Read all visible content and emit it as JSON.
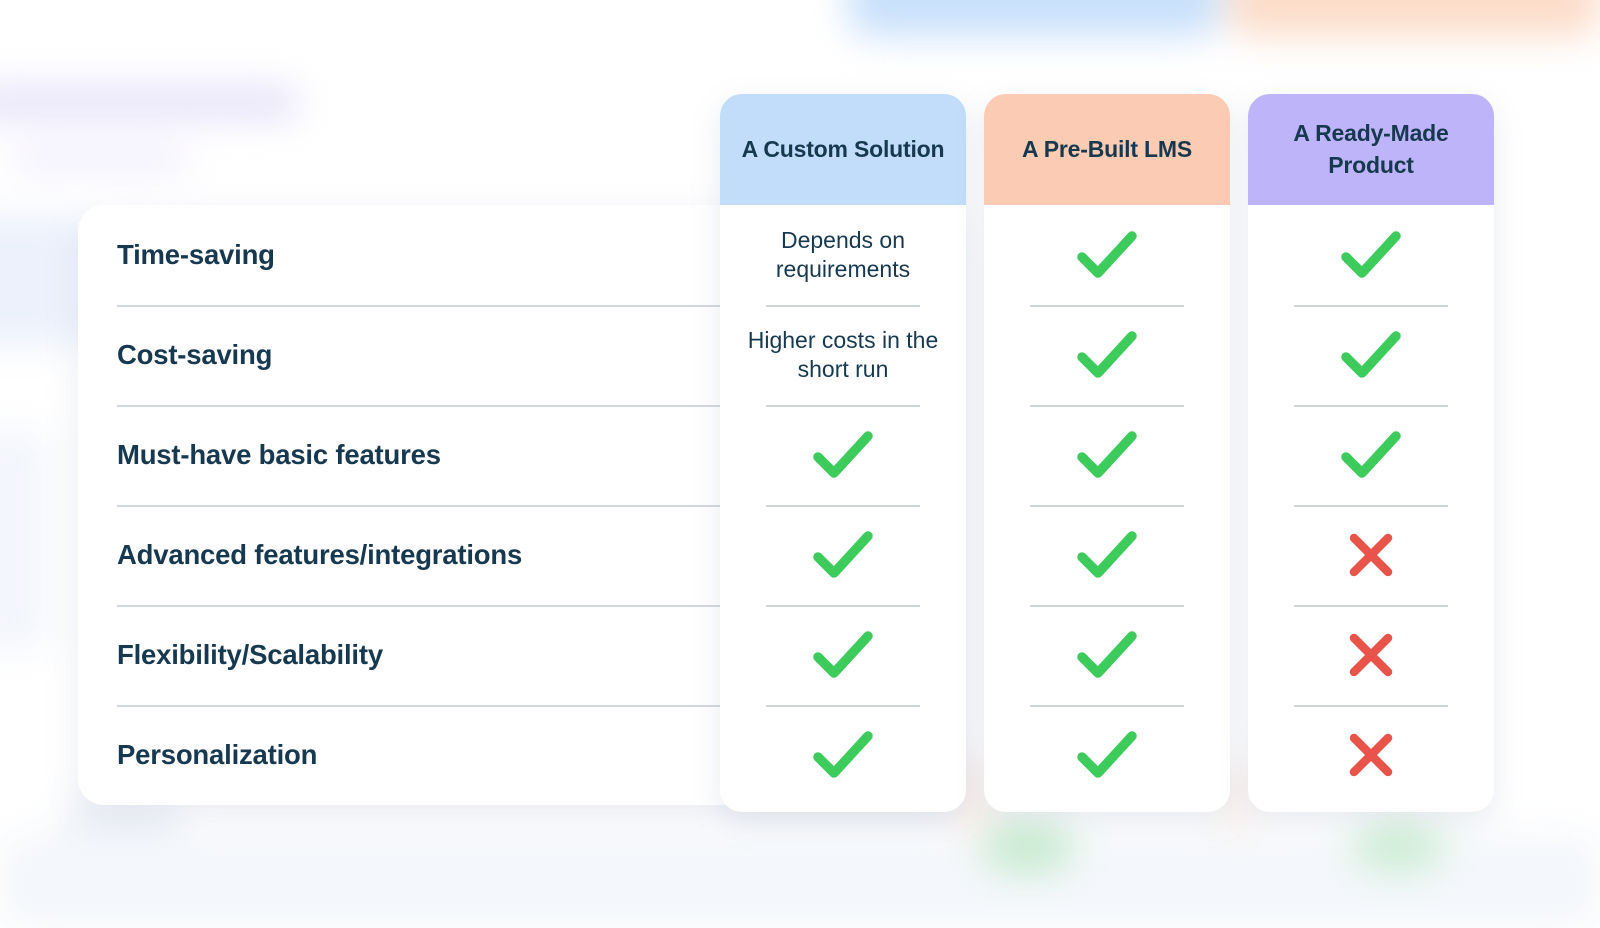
{
  "colors": {
    "header_blue": "#C2DDFA",
    "header_peach": "#FBCBB3",
    "header_purple": "#BEB4FA",
    "text_navy": "#17394F",
    "check_green": "#3DCB5B",
    "cross_red": "#E8534A",
    "divider_grey": "#D3D8DE",
    "panel_white": "#FFFFFF"
  },
  "table": {
    "row_header_label": "",
    "columns": [
      {
        "label": "A Custom Solution",
        "accent": "#C2DDFA",
        "accent_name": "header_blue"
      },
      {
        "label": "A Pre-Built LMS",
        "accent": "#FBCBB3",
        "accent_name": "header_peach"
      },
      {
        "label": "A Ready-Made Product",
        "accent": "#BEB4FA",
        "accent_name": "header_purple"
      }
    ],
    "rows": [
      {
        "label": "Time-saving",
        "cells": [
          {
            "type": "text",
            "value": "Depends on requirements",
            "icon": ""
          },
          {
            "type": "check",
            "value": "Yes",
            "icon": "check-icon"
          },
          {
            "type": "check",
            "value": "Yes",
            "icon": "check-icon"
          }
        ]
      },
      {
        "label": "Cost-saving",
        "cells": [
          {
            "type": "text",
            "value": "Higher costs in the short run",
            "icon": ""
          },
          {
            "type": "check",
            "value": "Yes",
            "icon": "check-icon"
          },
          {
            "type": "check",
            "value": "Yes",
            "icon": "check-icon"
          }
        ]
      },
      {
        "label": "Must-have basic features",
        "cells": [
          {
            "type": "check",
            "value": "Yes",
            "icon": "check-icon"
          },
          {
            "type": "check",
            "value": "Yes",
            "icon": "check-icon"
          },
          {
            "type": "check",
            "value": "Yes",
            "icon": "check-icon"
          }
        ]
      },
      {
        "label": "Advanced features/integrations",
        "cells": [
          {
            "type": "check",
            "value": "Yes",
            "icon": "check-icon"
          },
          {
            "type": "check",
            "value": "Yes",
            "icon": "check-icon"
          },
          {
            "type": "cross",
            "value": "No",
            "icon": "cross-icon"
          }
        ]
      },
      {
        "label": "Flexibility/Scalability",
        "cells": [
          {
            "type": "check",
            "value": "Yes",
            "icon": "check-icon"
          },
          {
            "type": "check",
            "value": "Yes",
            "icon": "check-icon"
          },
          {
            "type": "cross",
            "value": "No",
            "icon": "cross-icon"
          }
        ]
      },
      {
        "label": "Personalization",
        "cells": [
          {
            "type": "check",
            "value": "Yes",
            "icon": "check-icon"
          },
          {
            "type": "check",
            "value": "Yes",
            "icon": "check-icon"
          },
          {
            "type": "cross",
            "value": "No",
            "icon": "cross-icon"
          }
        ]
      }
    ]
  }
}
